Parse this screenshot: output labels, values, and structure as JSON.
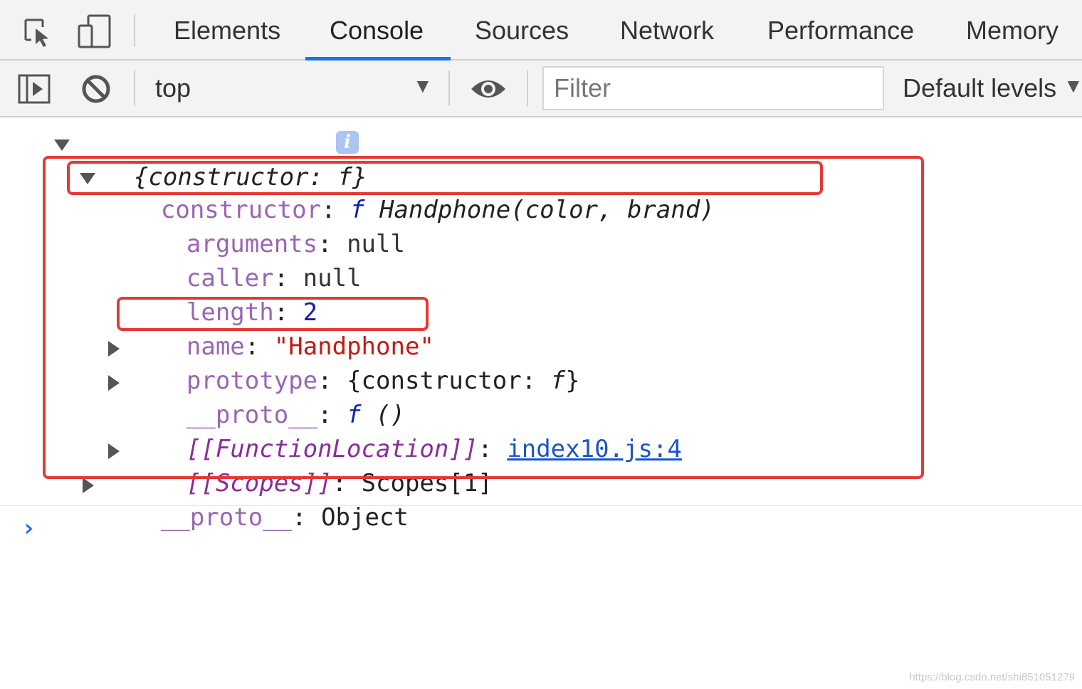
{
  "tabs": {
    "elements": "Elements",
    "console": "Console",
    "sources": "Sources",
    "network": "Network",
    "performance": "Performance",
    "memory": "Memory",
    "active": "Console"
  },
  "toolbar": {
    "context": "top",
    "filter_placeholder": "Filter",
    "levels": "Default levels"
  },
  "console": {
    "root": {
      "open_brace": "{",
      "key": "constructor",
      "colon": ": ",
      "f": "f",
      "close_brace": "}"
    },
    "constructor_line": {
      "key": "constructor",
      "colon": ": ",
      "f": "f",
      "signature": " Handphone(color, brand)"
    },
    "props": {
      "arguments": {
        "key": "arguments",
        "value": "null"
      },
      "caller": {
        "key": "caller",
        "value": "null"
      },
      "length": {
        "key": "length",
        "value": "2"
      },
      "name": {
        "key": "name",
        "value": "\"Handphone\""
      },
      "prototype": {
        "key": "prototype",
        "value": "{constructor: ",
        "f": "f",
        "close": "}"
      },
      "proto_fn": {
        "key": "__proto__",
        "f": "f",
        "value": " ()"
      },
      "function_location": {
        "key": "[[FunctionLocation]]",
        "link": "index10.js:4"
      },
      "scopes": {
        "key": "[[Scopes]]",
        "value": "Scopes[1]"
      }
    },
    "outer_proto": {
      "key": "__proto__",
      "value": "Object"
    },
    "prompt": "›"
  },
  "colors": {
    "highlight_border": "#e53935",
    "tab_underline": "#1a73e8",
    "key": "#9c64b4",
    "string": "#c41a16",
    "number": "#1a1aa6",
    "link": "#1a55c8"
  },
  "icons": [
    "inspect-element-icon",
    "device-toggle-icon",
    "sidebar-toggle-icon",
    "clear-console-icon",
    "eye-icon",
    "info-icon"
  ],
  "watermark": "https://blog.csdn.net/shi851051279"
}
